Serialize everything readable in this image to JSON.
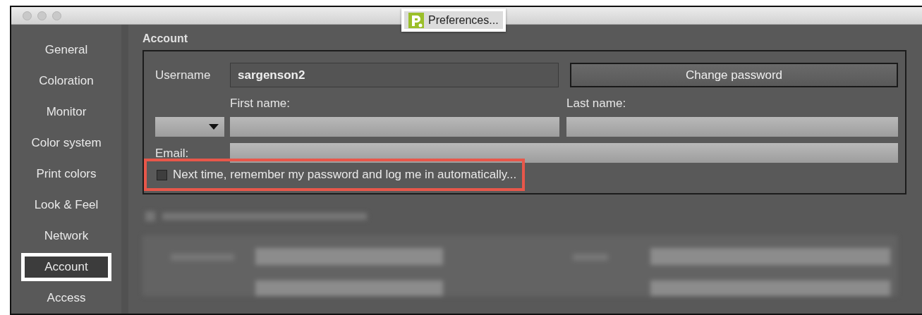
{
  "window": {
    "title": "Preferences...",
    "title_annotated": true
  },
  "sidebar": {
    "items": [
      {
        "label": "General",
        "selected": false,
        "annotated": false
      },
      {
        "label": "Coloration",
        "selected": false,
        "annotated": false
      },
      {
        "label": "Monitor",
        "selected": false,
        "annotated": false
      },
      {
        "label": "Color system",
        "selected": false,
        "annotated": false
      },
      {
        "label": "Print colors",
        "selected": false,
        "annotated": false
      },
      {
        "label": "Look & Feel",
        "selected": false,
        "annotated": false
      },
      {
        "label": "Network",
        "selected": false,
        "annotated": false
      },
      {
        "label": "Account",
        "selected": true,
        "annotated": true
      },
      {
        "label": "Access",
        "selected": false,
        "annotated": false
      }
    ]
  },
  "account": {
    "heading": "Account",
    "username_label": "Username",
    "username": "sargenson2",
    "change_password": "Change password",
    "first_name_label": "First name:",
    "last_name_label": "Last name:",
    "email_label": "Email:",
    "remember": {
      "label": "Next time, remember my password and log me in automatically...",
      "checked": false,
      "annotated": true
    }
  }
}
